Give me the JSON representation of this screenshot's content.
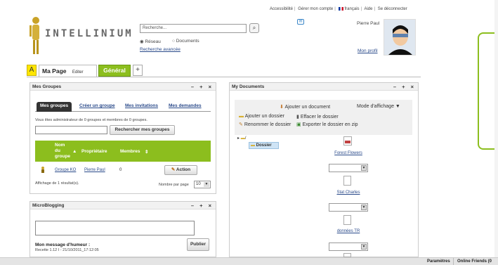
{
  "top_links": {
    "accessibility": "Accessibilité",
    "account": "Gérer mon compte",
    "language": "français",
    "help": "Aide",
    "logout": "Se déconnecter"
  },
  "logo_text": "INTELLINIUM",
  "search": {
    "placeholder": "Recherche...",
    "icon": "search-icon",
    "radio_network": "Réseau",
    "radio_documents": "Documents",
    "advanced": "Recherche avancée"
  },
  "user": {
    "name": "Pierre Paul",
    "profile_link": "Mon profil"
  },
  "tabs": {
    "a": "A",
    "ma_page": "Ma Page",
    "edit": "Editer",
    "general": "Général",
    "add": "+"
  },
  "groups_panel": {
    "title": "Mes Groupes",
    "controls": "– + ×",
    "tabs": [
      "Mes groupes",
      "Créer un groupe",
      "Mes invitations",
      "Mes demandes"
    ],
    "info": "Vous êtes administrateur de 0 groupes et membres de 0 groupes.",
    "search_button": "Rechercher mes groupes",
    "columns": {
      "name": "Nom du groupe",
      "owner": "Propriétaire",
      "members": "Membres"
    },
    "rows": [
      {
        "name": "Groupe KO",
        "owner": "Pierre Paul",
        "members": "0",
        "action": "Action"
      }
    ],
    "footer": "Affichage de 1 résultat(s).",
    "per_page_label": "Nombre par page",
    "per_page": "10"
  },
  "micro_panel": {
    "title": "MicroBlogging",
    "controls": "– + ×",
    "mood_label": "Mon message d'humeur :",
    "mood_meta": "Recette 1.12 I - 21/10/2011_17:12:05",
    "publish": "Publier"
  },
  "docs_panel": {
    "title": "My Documents",
    "controls": "– + ×",
    "add_doc": "Ajouter un document",
    "display_mode": "Mode d'affichage ▼",
    "add_folder": "Ajouter un dossier",
    "delete_folder": "Effacer le dossier",
    "rename_folder": "Renommer le dossier",
    "export_zip": "Exporter le dossier en zip",
    "tree_root": "/",
    "tree_folder": "Dossier",
    "files": [
      "Forest Flowers",
      "Stat Charles",
      "données TR"
    ]
  },
  "bottom_bar": {
    "settings": "Paramètres",
    "online": "Online Friends (0"
  },
  "colors": {
    "accent_green": "#8cbe1e",
    "tab_yellow": "#ffe600",
    "link": "#2a4a8a"
  }
}
